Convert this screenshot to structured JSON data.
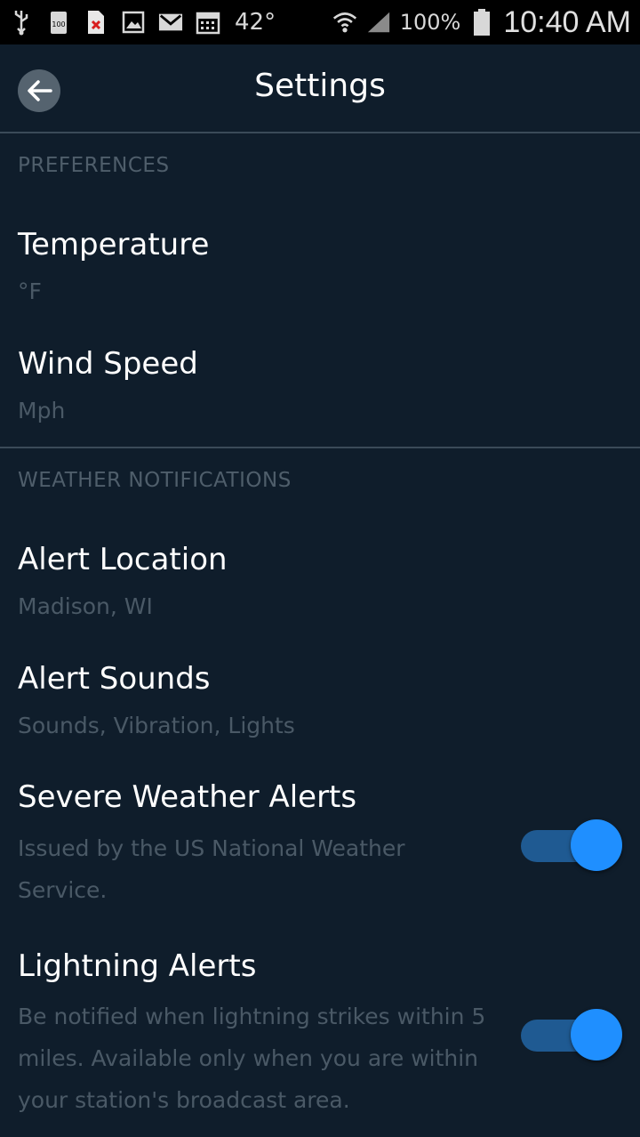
{
  "status_bar": {
    "temperature": "42°",
    "battery": "100%",
    "time": "10:40 AM",
    "icons": [
      "usb-icon",
      "battery-100-icon",
      "file-x-icon",
      "image-icon",
      "gmail-icon",
      "calendar-icon",
      "wifi-icon",
      "signal-icon",
      "battery-icon"
    ]
  },
  "app_bar": {
    "title": "Settings",
    "back_icon": "back-arrow-icon"
  },
  "preferences": {
    "header": "PREFERENCES",
    "items": [
      {
        "title": "Temperature",
        "value": "°F"
      },
      {
        "title": "Wind Speed",
        "value": "Mph"
      }
    ]
  },
  "notifications": {
    "header": "WEATHER NOTIFICATIONS",
    "items": [
      {
        "title": "Alert Location",
        "value": "Madison, WI"
      },
      {
        "title": "Alert Sounds",
        "value": "Sounds, Vibration, Lights"
      },
      {
        "title": "Severe Weather Alerts",
        "desc_line1": "Issued by the US National Weather",
        "desc_line2": "Service.",
        "enabled": true
      },
      {
        "title": "Lightning Alerts",
        "desc_line1": "Be notified when lightning strikes within 5",
        "desc_line2": "miles. Available only when you are within",
        "desc_line3": "your station's broadcast area.",
        "enabled": true
      }
    ]
  },
  "colors": {
    "background": "#0f1d2b",
    "accent": "#1f8fff",
    "secondary_text": "#4a5966"
  }
}
